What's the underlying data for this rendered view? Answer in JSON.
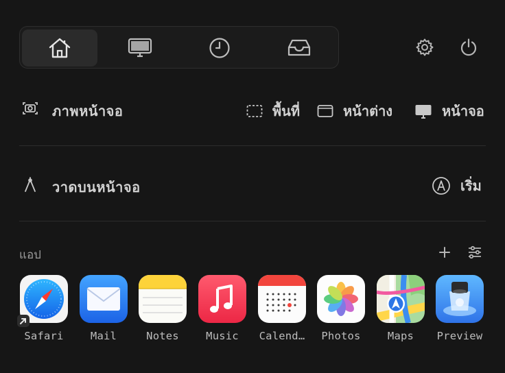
{
  "tabs": [
    {
      "id": "home",
      "icon": "home-icon",
      "active": true
    },
    {
      "id": "screen",
      "icon": "monitor-icon",
      "active": false
    },
    {
      "id": "history",
      "icon": "clock-icon",
      "active": false
    },
    {
      "id": "inbox",
      "icon": "tray-icon",
      "active": false
    }
  ],
  "top_actions": {
    "settings_icon": "gear-icon",
    "power_icon": "power-icon"
  },
  "screenshot": {
    "label": "ภาพหน้าจอ",
    "icon": "camera-icon",
    "options": [
      {
        "label": "พื้นที่",
        "icon": "dashed-rect-icon"
      },
      {
        "label": "หน้าต่าง",
        "icon": "window-icon"
      },
      {
        "label": "หน้าจอ",
        "icon": "display-icon"
      }
    ]
  },
  "draw": {
    "label": "วาดบนหน้าจอ",
    "icon": "compass-icon",
    "start_label": "เริ่ม",
    "start_icon": "pen-circle-icon"
  },
  "apps": {
    "title": "แอป",
    "add_icon": "plus-icon",
    "settings_icon": "sliders-icon",
    "items": [
      {
        "name": "Safari",
        "icon": "safari-icon"
      },
      {
        "name": "Mail",
        "icon": "mail-icon"
      },
      {
        "name": "Notes",
        "icon": "notes-icon"
      },
      {
        "name": "Music",
        "icon": "music-icon"
      },
      {
        "name": "Calend…",
        "icon": "calendar-icon"
      },
      {
        "name": "Photos",
        "icon": "photos-icon"
      },
      {
        "name": "Maps",
        "icon": "maps-icon"
      },
      {
        "name": "Preview",
        "icon": "preview-icon"
      }
    ]
  }
}
